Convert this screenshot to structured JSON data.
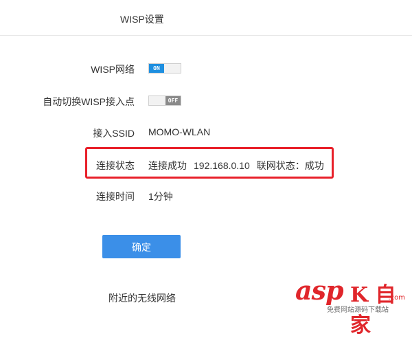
{
  "header": {
    "title": "WISP设置"
  },
  "form": {
    "wisp_network": {
      "label": "WISP网络",
      "toggle_text": "ON",
      "enabled": true
    },
    "auto_switch": {
      "label": "自动切换WISP接入点",
      "toggle_text": "OFF",
      "enabled": false
    },
    "ssid": {
      "label": "接入SSID",
      "value": "MOMO-WLAN"
    },
    "connection_status": {
      "label": "连接状态",
      "status": "连接成功",
      "ip": "192.168.0.10",
      "internet_status": "联网状态：成功"
    },
    "connection_time": {
      "label": "连接时间",
      "value": "1分钟"
    }
  },
  "confirm_label": "确定",
  "nearby": {
    "title": "附近的无线网络"
  },
  "watermark": {
    "brand": "asp",
    "brand_cn": "K 自 家",
    "domain": ".com",
    "slogan": "免费网站源码下载站"
  },
  "colors": {
    "toggle_on": "#1e8fe0",
    "toggle_off": "#8a8a8a",
    "highlight": "#e8202a",
    "button": "#3b8fe8",
    "watermark": "#e0262b"
  }
}
